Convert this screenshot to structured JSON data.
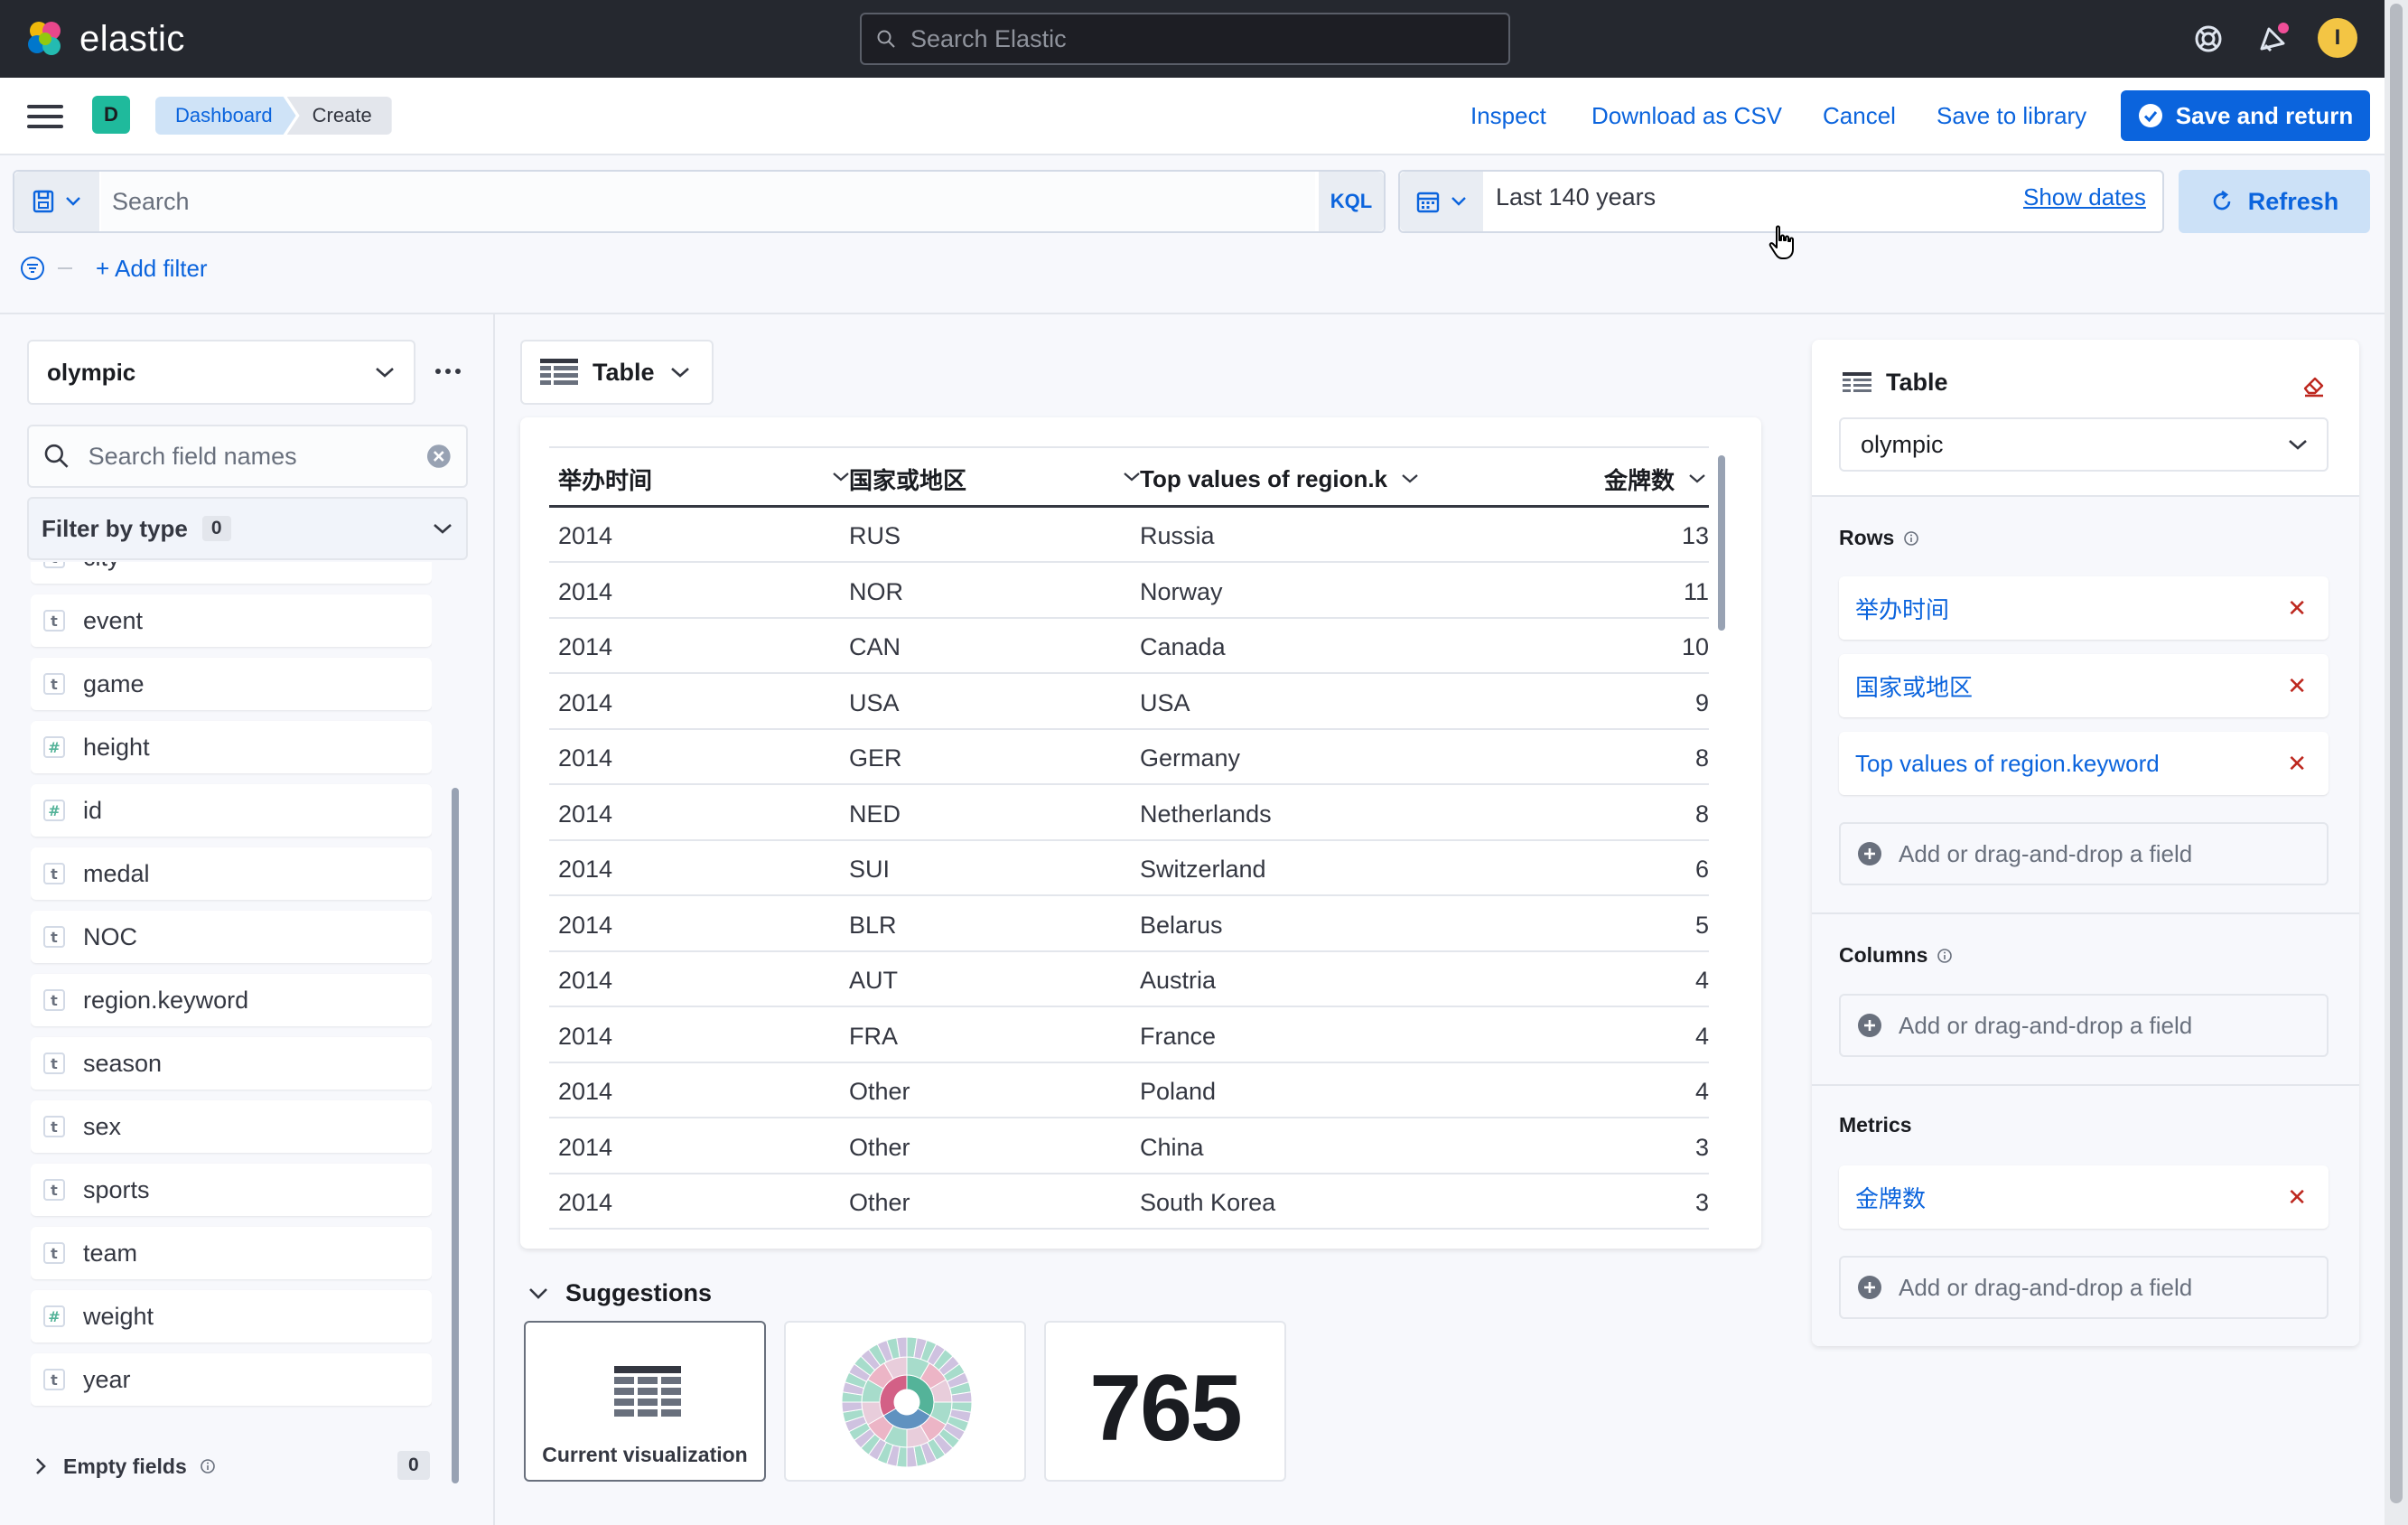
{
  "header": {
    "logo_text": "elastic",
    "search_placeholder": "Search Elastic",
    "avatar_initial": "I",
    "icons": [
      "help-icon",
      "newsfeed-icon"
    ]
  },
  "appbar": {
    "space_initial": "D",
    "breadcrumbs": [
      "Dashboard",
      "Create"
    ],
    "links": {
      "inspect": "Inspect",
      "download_csv": "Download as CSV",
      "cancel": "Cancel",
      "save_library": "Save to library"
    },
    "save_return": "Save and return"
  },
  "query": {
    "placeholder": "Search",
    "language": "KQL",
    "date_range": "Last 140 years",
    "show_dates": "Show dates",
    "refresh": "Refresh",
    "add_filter": "+ Add filter"
  },
  "sidebar": {
    "data_view": "olympic",
    "field_search_placeholder": "Search field names",
    "filter_by_type": "Filter by type",
    "filter_count": "0",
    "fields": [
      {
        "name": "city",
        "type": "t"
      },
      {
        "name": "event",
        "type": "t"
      },
      {
        "name": "game",
        "type": "t"
      },
      {
        "name": "height",
        "type": "#"
      },
      {
        "name": "id",
        "type": "#"
      },
      {
        "name": "medal",
        "type": "t"
      },
      {
        "name": "NOC",
        "type": "t"
      },
      {
        "name": "region.keyword",
        "type": "t"
      },
      {
        "name": "season",
        "type": "t"
      },
      {
        "name": "sex",
        "type": "t"
      },
      {
        "name": "sports",
        "type": "t"
      },
      {
        "name": "team",
        "type": "t"
      },
      {
        "name": "weight",
        "type": "#"
      },
      {
        "name": "year",
        "type": "t"
      }
    ],
    "empty_fields_label": "Empty fields",
    "empty_fields_count": "0"
  },
  "workspace": {
    "vis_type": "Table",
    "columns": [
      "举办时间",
      "国家或地区",
      "Top values of region.k",
      "金牌数"
    ],
    "rows": [
      [
        "2014",
        "RUS",
        "Russia",
        "13"
      ],
      [
        "2014",
        "NOR",
        "Norway",
        "11"
      ],
      [
        "2014",
        "CAN",
        "Canada",
        "10"
      ],
      [
        "2014",
        "USA",
        "USA",
        "9"
      ],
      [
        "2014",
        "GER",
        "Germany",
        "8"
      ],
      [
        "2014",
        "NED",
        "Netherlands",
        "8"
      ],
      [
        "2014",
        "SUI",
        "Switzerland",
        "6"
      ],
      [
        "2014",
        "BLR",
        "Belarus",
        "5"
      ],
      [
        "2014",
        "AUT",
        "Austria",
        "4"
      ],
      [
        "2014",
        "FRA",
        "France",
        "4"
      ],
      [
        "2014",
        "Other",
        "Poland",
        "4"
      ],
      [
        "2014",
        "Other",
        "China",
        "3"
      ],
      [
        "2014",
        "Other",
        "South Korea",
        "3"
      ]
    ],
    "suggestions_label": "Suggestions",
    "suggestion_current": "Current visualization",
    "suggestion_metric": "765"
  },
  "config": {
    "title": "Table",
    "layer": "olympic",
    "rows_label": "Rows",
    "rows": [
      "举办时间",
      "国家或地区",
      "Top values of region.keyword"
    ],
    "columns_label": "Columns",
    "metrics_label": "Metrics",
    "metrics": [
      "金牌数"
    ],
    "add_field": "Add or drag-and-drop a field"
  },
  "colors": {
    "accent": "#0b64dd",
    "header_bg": "#25282f",
    "danger": "#bd271e"
  }
}
